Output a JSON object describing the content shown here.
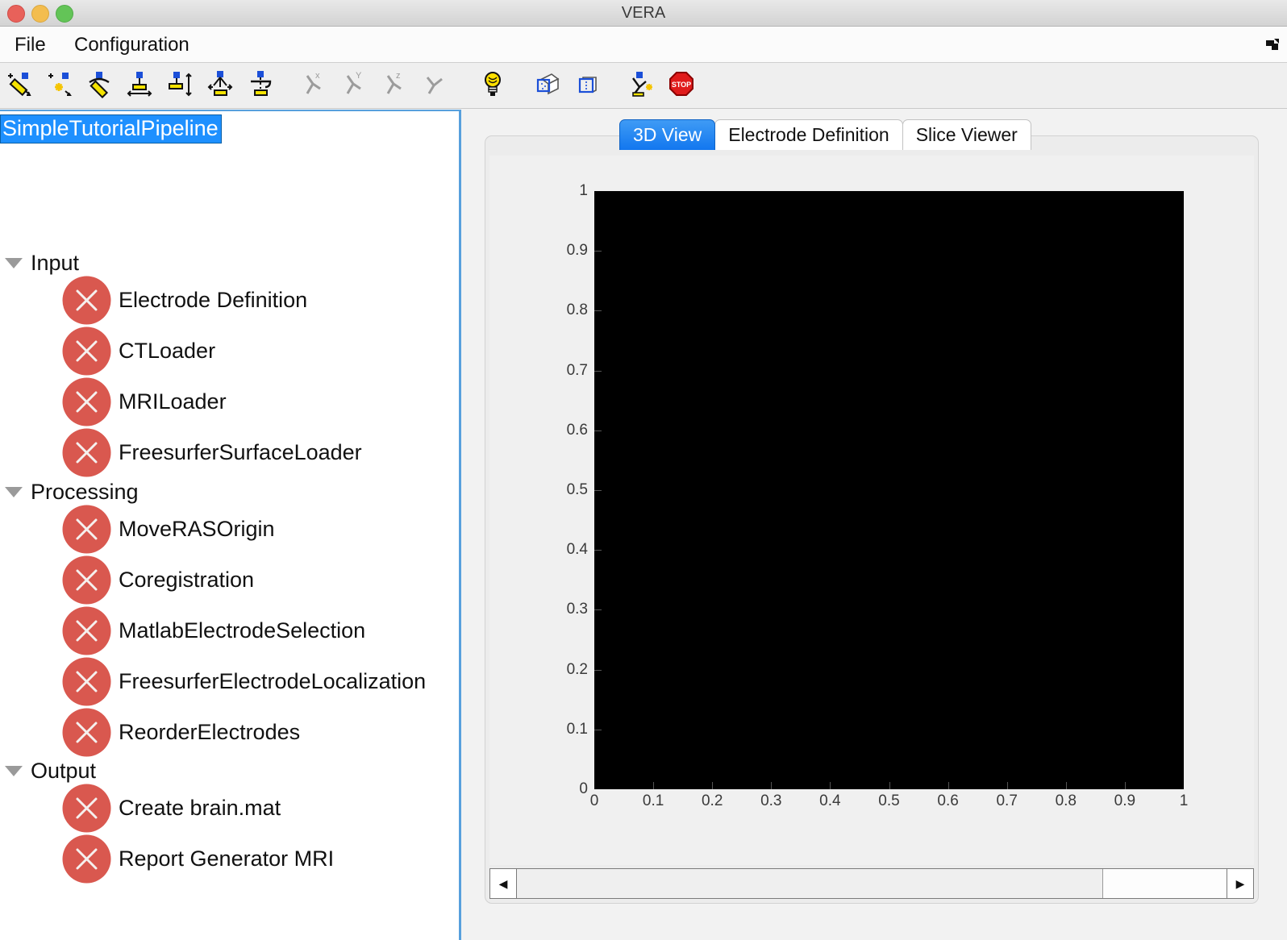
{
  "window": {
    "title": "VERA",
    "controls": [
      {
        "name": "close",
        "icon": "close-window-dot"
      },
      {
        "name": "minimize",
        "icon": "minimize-window-dot"
      },
      {
        "name": "maximize",
        "icon": "maximize-window-dot"
      }
    ]
  },
  "menubar": {
    "items": [
      {
        "label": "File"
      },
      {
        "label": "Configuration"
      }
    ],
    "corner_icon": "undock-arrow-icon"
  },
  "toolbar": {
    "buttons": [
      {
        "name": "new-pipeline",
        "icon": "pencil-new-icon",
        "enabled": true
      },
      {
        "name": "new-from-template",
        "icon": "sparkle-new-icon",
        "enabled": true
      },
      {
        "name": "edit-component",
        "icon": "pencil-edit-icon",
        "enabled": true
      },
      {
        "name": "align-horizontal",
        "icon": "align-horizontal-icon",
        "enabled": true
      },
      {
        "name": "align-vertical",
        "icon": "align-vertical-icon",
        "enabled": true
      },
      {
        "name": "distribute-nodes",
        "icon": "distribute-nodes-icon",
        "enabled": true
      },
      {
        "name": "group-nodes",
        "icon": "group-nodes-icon",
        "enabled": true
      },
      {
        "name": "axis-x",
        "icon": "axis-x-icon",
        "enabled": false
      },
      {
        "name": "axis-y",
        "icon": "axis-y-icon",
        "enabled": false
      },
      {
        "name": "axis-z",
        "icon": "axis-z-icon",
        "enabled": false
      },
      {
        "name": "axis-free",
        "icon": "axis-free-icon",
        "enabled": false
      },
      {
        "name": "lighting",
        "icon": "lightbulb-icon",
        "enabled": true
      },
      {
        "name": "show-3d-box",
        "icon": "cube-3d-icon",
        "enabled": true
      },
      {
        "name": "show-2d-box",
        "icon": "square-2d-icon",
        "enabled": true
      },
      {
        "name": "run-pipeline",
        "icon": "run-branch-icon",
        "enabled": true
      },
      {
        "name": "stop-pipeline",
        "icon": "stop-sign-icon",
        "enabled": true
      }
    ]
  },
  "tree": {
    "root": {
      "label": "SimpleTutorialPipeline",
      "selected": true
    },
    "groups": [
      {
        "label": "Input",
        "expanded": true,
        "nodes": [
          {
            "label": "Electrode Definition",
            "status": "error"
          },
          {
            "label": "CTLoader",
            "status": "error"
          },
          {
            "label": "MRILoader",
            "status": "error"
          },
          {
            "label": "FreesurferSurfaceLoader",
            "status": "error"
          }
        ]
      },
      {
        "label": "Processing",
        "expanded": true,
        "nodes": [
          {
            "label": "MoveRASOrigin",
            "status": "error"
          },
          {
            "label": "Coregistration",
            "status": "error"
          },
          {
            "label": "MatlabElectrodeSelection",
            "status": "error"
          },
          {
            "label": "FreesurferElectrodeLocalization",
            "status": "error"
          },
          {
            "label": "ReorderElectrodes",
            "status": "error"
          }
        ]
      },
      {
        "label": "Output",
        "expanded": true,
        "nodes": [
          {
            "label": "Create brain.mat",
            "status": "error"
          },
          {
            "label": "Report Generator MRI",
            "status": "error"
          }
        ]
      }
    ]
  },
  "tabs": [
    {
      "label": "3D View",
      "active": true
    },
    {
      "label": "Electrode Definition",
      "active": false
    },
    {
      "label": "Slice Viewer",
      "active": false
    }
  ],
  "scrollbar": {
    "left_arrow": "◀",
    "right_arrow": "▶"
  },
  "colors": {
    "accent_blue": "#1e90ff",
    "tab_active": "#1277ef",
    "node_error": "#d9584f",
    "plot_background": "#000000",
    "panel_background": "#f0f0f0"
  },
  "chart_data": {
    "type": "scatter",
    "title": "",
    "xlabel": "",
    "ylabel": "",
    "xlim": [
      0,
      1
    ],
    "ylim": [
      0,
      1
    ],
    "xticks": [
      "0",
      "0.1",
      "0.2",
      "0.3",
      "0.4",
      "0.5",
      "0.6",
      "0.7",
      "0.8",
      "0.9",
      "1"
    ],
    "yticks": [
      "0",
      "0.1",
      "0.2",
      "0.3",
      "0.4",
      "0.5",
      "0.6",
      "0.7",
      "0.8",
      "0.9",
      "1"
    ],
    "grid": false,
    "legend": null,
    "series": [],
    "notes": "Empty 3D view axes with black background; no data rendered."
  }
}
